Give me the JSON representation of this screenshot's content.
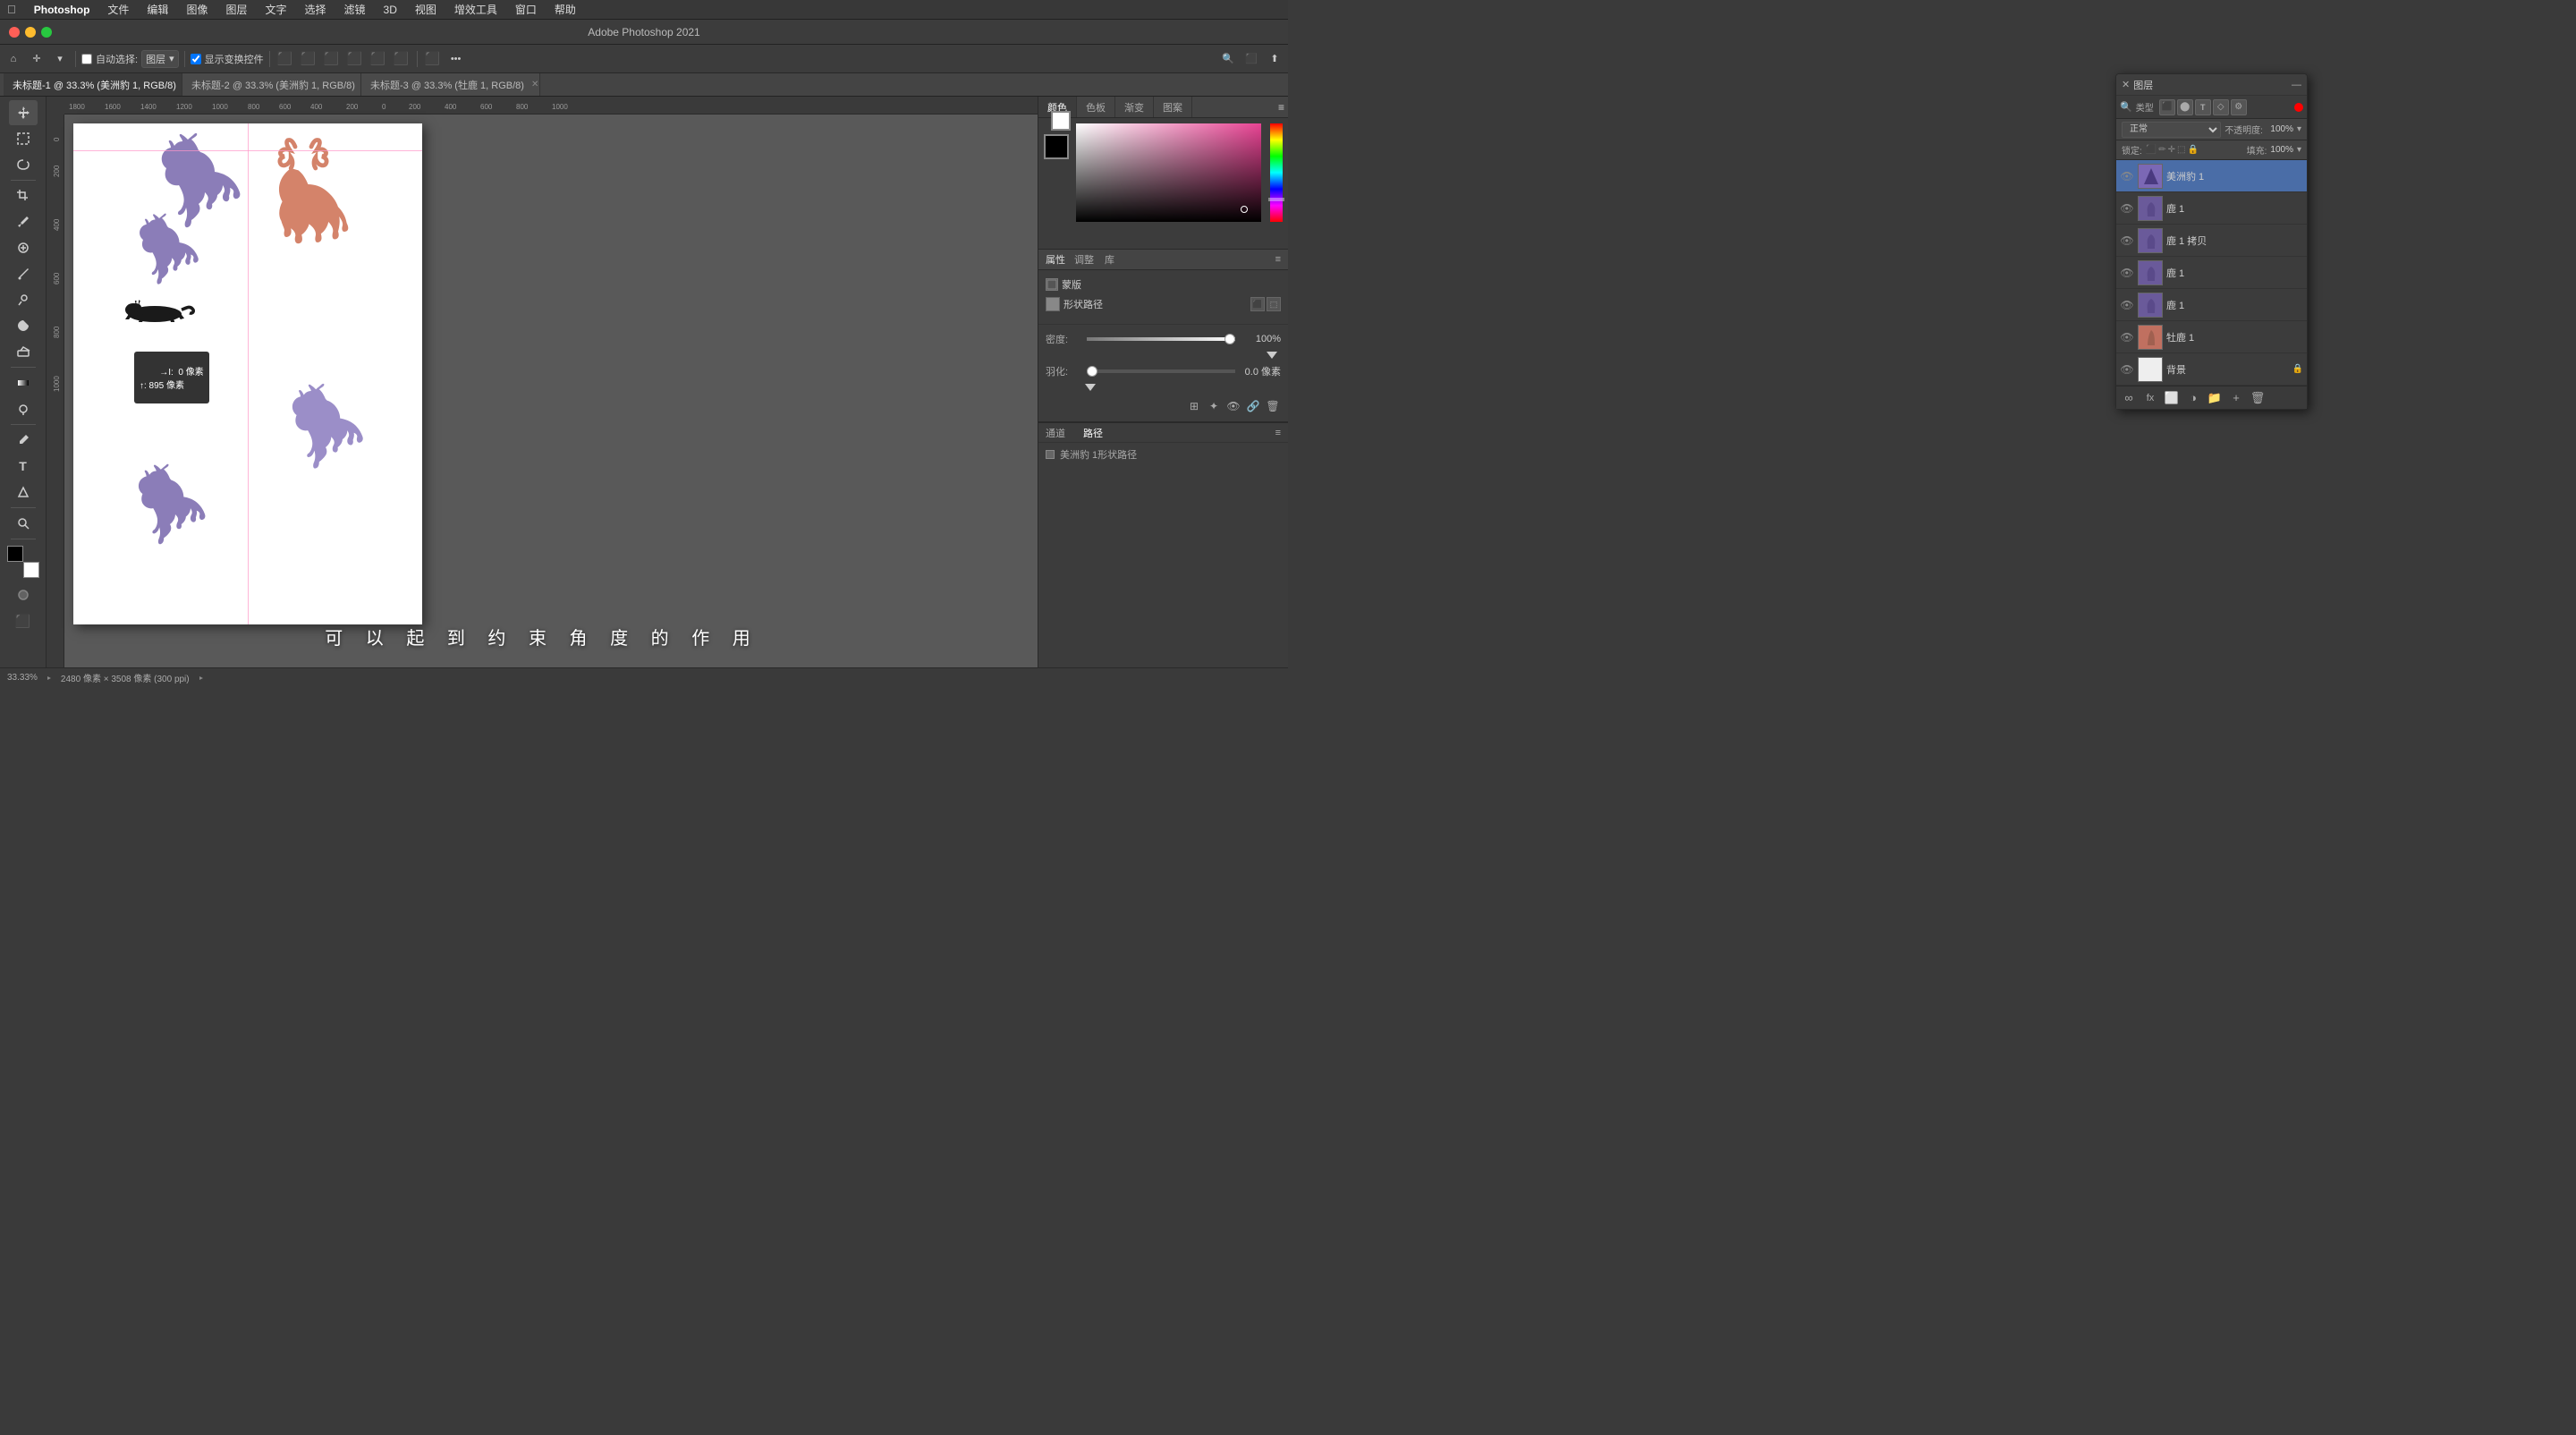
{
  "menubar": {
    "app": "Photoshop",
    "menus": [
      "文件",
      "编辑",
      "图像",
      "图层",
      "文字",
      "选择",
      "滤镜",
      "3D",
      "视图",
      "增效工具",
      "窗口",
      "帮助"
    ]
  },
  "titlebar": {
    "title": "Adobe Photoshop 2021"
  },
  "toolbar": {
    "auto_select_label": "自动选择:",
    "layer_label": "图层",
    "show_transform_label": "显示变换控件",
    "home_icon": "⌂",
    "move_icon": "✛",
    "dots_icon": "•••"
  },
  "tabs": [
    {
      "label": "未标题-1 @ 33.3% (美洲豹 1, RGB/8)",
      "active": true
    },
    {
      "label": "未标题-2 @ 33.3% (美洲豹 1, RGB/8)",
      "active": false
    },
    {
      "label": "未标题-3 @ 33.3% (牡鹿 1, RGB/8)",
      "active": false
    }
  ],
  "layers_panel": {
    "title": "图层",
    "filter_label": "类型",
    "mode_label": "正常",
    "opacity_label": "不透明度:",
    "opacity_value": "100%",
    "fill_label": "填充:",
    "fill_value": "100%",
    "lock_label": "锁定:",
    "items": [
      {
        "name": "美洲豹 1",
        "visible": true,
        "active": true,
        "color": "#7b68b5"
      },
      {
        "name": "鹿 1",
        "visible": true,
        "active": false,
        "color": "#8b7db8"
      },
      {
        "name": "鹿 1 拷贝",
        "visible": true,
        "active": false,
        "color": "#8b7db8"
      },
      {
        "name": "鹿 1",
        "visible": true,
        "active": false,
        "color": "#8b7db8"
      },
      {
        "name": "鹿 1",
        "visible": true,
        "active": false,
        "color": "#8b7db8"
      },
      {
        "name": "牡鹿 1",
        "visible": true,
        "active": false,
        "color": "#d4836a"
      },
      {
        "name": "背景",
        "visible": true,
        "active": false,
        "color": "#fff",
        "lock": true
      }
    ]
  },
  "properties_panel": {
    "title": "属性",
    "tabs": [
      "调整",
      "库"
    ],
    "section_label": "蒙版",
    "shape_path_label": "形状路径",
    "density_label": "密度:",
    "density_value": "100%",
    "feather_label": "羽化:",
    "feather_value": "0.0 像素"
  },
  "path_panel": {
    "tabs": [
      "通道",
      "路径"
    ],
    "active_tab": "路径",
    "items": [
      {
        "name": "美洲豹 1形状路径"
      }
    ]
  },
  "tooltip": {
    "x_label": "→I:",
    "x_value": "0 像素",
    "y_label": "↑:",
    "y_value": "895 像素"
  },
  "statusbar": {
    "zoom": "33.33%",
    "dimensions": "2480 像素 × 3508 像素 (300 ppi)"
  },
  "subtitle": {
    "text": "可 以 起 到 约 束 角 度 的 作 用"
  },
  "color_panel": {
    "tabs": [
      "颜色",
      "色板",
      "渐变",
      "图案"
    ]
  }
}
